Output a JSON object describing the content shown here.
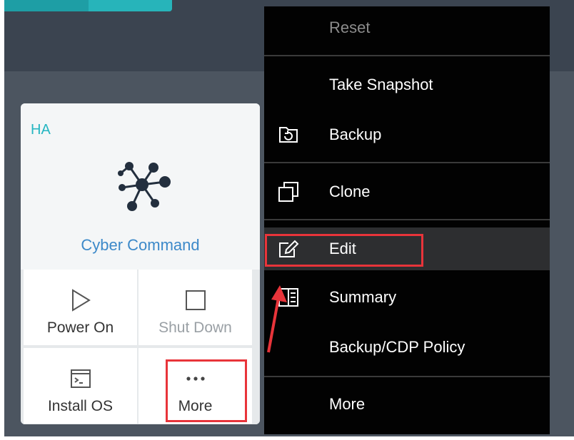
{
  "card": {
    "badge": "HA",
    "name": "Cyber Command",
    "actions": [
      {
        "label": "Power On",
        "icon": "play-icon"
      },
      {
        "label": "Shut Down",
        "icon": "stop-icon"
      },
      {
        "label": "Install OS",
        "icon": "terminal-icon"
      },
      {
        "label": "More",
        "icon": "ellipsis-icon"
      }
    ]
  },
  "menu": {
    "items": [
      {
        "label": "Reset",
        "icon": ""
      },
      {
        "label": "Take Snapshot",
        "icon": ""
      },
      {
        "label": "Backup",
        "icon": "backup-icon"
      },
      {
        "label": "Clone",
        "icon": "clone-icon"
      },
      {
        "label": "Edit",
        "icon": "edit-icon"
      },
      {
        "label": "Summary",
        "icon": "summary-icon"
      },
      {
        "label": "Backup/CDP Policy",
        "icon": ""
      },
      {
        "label": "More",
        "icon": ""
      }
    ]
  },
  "colors": {
    "accent": "#26b6c2",
    "name_link": "#3c89c9",
    "highlight_red": "#e8343a",
    "menu_bg": "#020202",
    "menu_hover": "#2d2e30"
  }
}
